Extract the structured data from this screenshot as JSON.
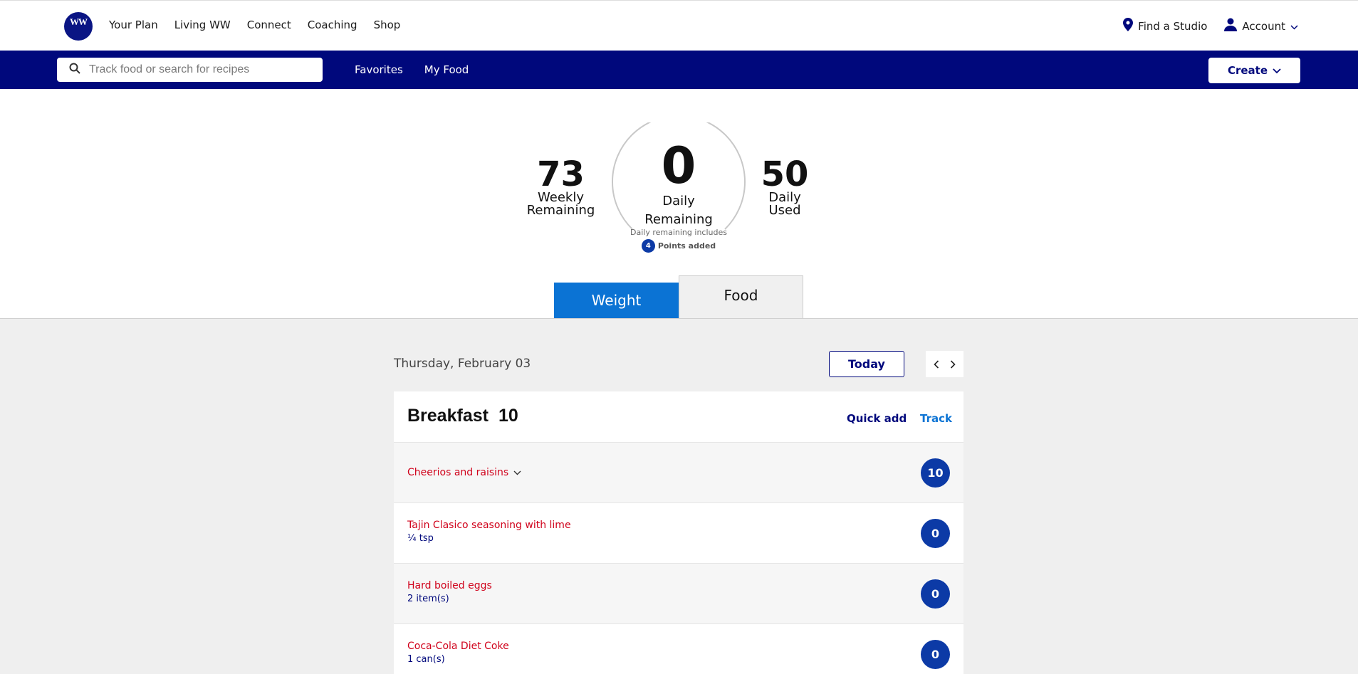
{
  "header": {
    "logo_text": "WW",
    "nav": [
      "Your Plan",
      "Living WW",
      "Connect",
      "Coaching",
      "Shop"
    ],
    "find_studio": "Find a Studio",
    "account": "Account"
  },
  "subbar": {
    "search_placeholder": "Track food or search for recipes",
    "links": [
      "Favorites",
      "My Food"
    ],
    "create_label": "Create"
  },
  "summary": {
    "weekly_remaining": "73",
    "weekly_label_1": "Weekly",
    "weekly_label_2": "Remaining",
    "daily_remaining": "0",
    "daily_label_1": "Daily",
    "daily_label_2": "Remaining",
    "daily_used": "50",
    "used_label_1": "Daily",
    "used_label_2": "Used",
    "includes_text": "Daily remaining includes",
    "points_added_count": "4",
    "points_added_text": "Points added"
  },
  "tabs": {
    "weight": "Weight",
    "food": "Food"
  },
  "log": {
    "date": "Thursday, February 03",
    "today_label": "Today",
    "meal": {
      "name": "Breakfast",
      "points": "10",
      "quick_add": "Quick add",
      "track": "Track"
    },
    "items": [
      {
        "name": "Cheerios and raisins",
        "serving": "",
        "points": "10"
      },
      {
        "name": "Tajin Clasico seasoning with lime",
        "serving": "¼ tsp",
        "points": "0"
      },
      {
        "name": "Hard boiled eggs",
        "serving": "2 item(s)",
        "points": "0"
      },
      {
        "name": "Coca-Cola Diet Coke",
        "serving": "1 can(s)",
        "points": "0"
      }
    ]
  },
  "colors": {
    "brand_navy": "#00087c",
    "tab_blue": "#0b73d4",
    "food_red": "#d0021b",
    "points_badge": "#0c3aa6"
  }
}
